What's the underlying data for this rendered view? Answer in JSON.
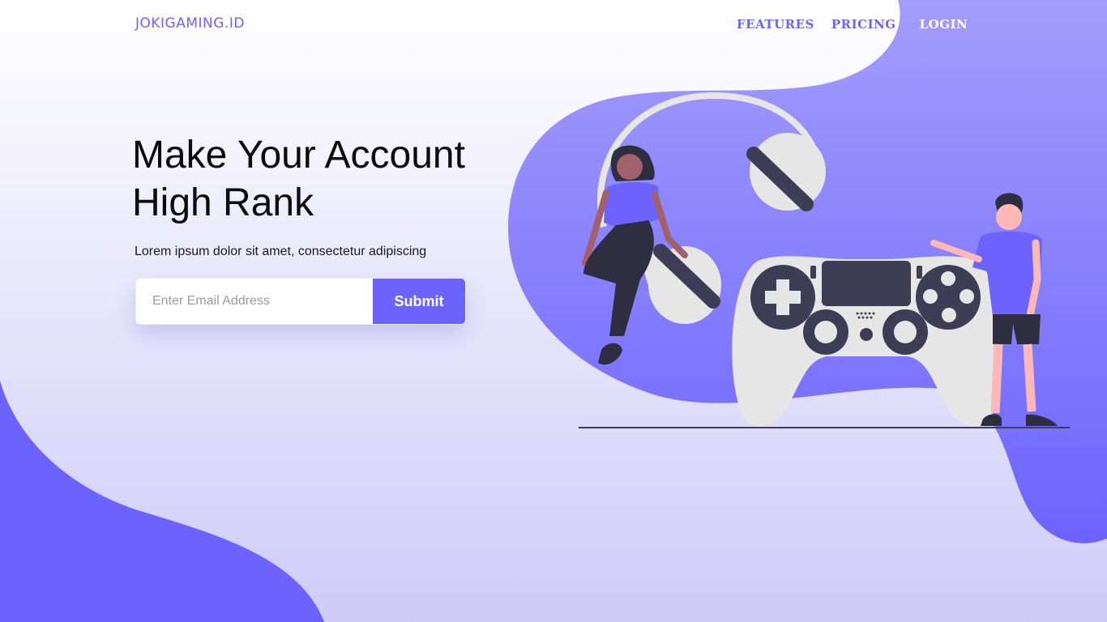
{
  "nav": {
    "logo": "JOKIGAMING.ID",
    "links": [
      "FEATURES",
      "PRICING",
      "LOGIN"
    ]
  },
  "hero": {
    "title": "Make Your Account High Rank",
    "subtitle": "Lorem ipsum dolor sit amet, consectetur adipiscing",
    "email_placeholder": "Enter Email Address",
    "submit_label": "Submit"
  },
  "colors": {
    "accent": "#6c63ff",
    "dark": "#2f2e41",
    "light_gray": "#e6e6e6",
    "skin": "#ffb8b8"
  },
  "illustration": {
    "icons": [
      "headphones-icon",
      "game-controller-icon",
      "woman-figure",
      "man-figure"
    ]
  }
}
